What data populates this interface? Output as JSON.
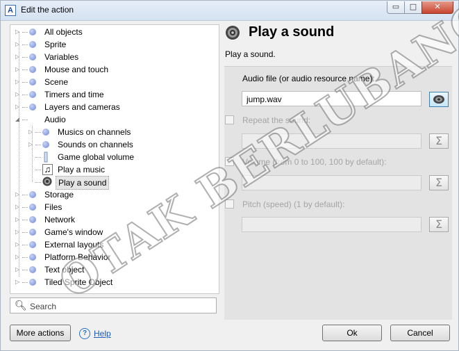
{
  "window": {
    "app_icon": "A",
    "title": "Edit the action",
    "buttons": {
      "minimize": "▭",
      "maximize": "□",
      "close": "✕"
    }
  },
  "tree": {
    "items": [
      {
        "label": "All objects",
        "icon": "bullet-icon",
        "level": 0,
        "expandable": true
      },
      {
        "label": "Sprite",
        "icon": "bullet-icon",
        "level": 0,
        "expandable": true
      },
      {
        "label": "Variables",
        "icon": "bullet-icon",
        "level": 0,
        "expandable": true
      },
      {
        "label": "Mouse and touch",
        "icon": "bullet-icon",
        "level": 0,
        "expandable": true
      },
      {
        "label": "Scene",
        "icon": "bullet-icon",
        "level": 0,
        "expandable": true
      },
      {
        "label": "Timers and time",
        "icon": "bullet-icon",
        "level": 0,
        "expandable": true
      },
      {
        "label": "Layers and cameras",
        "icon": "bullet-icon",
        "level": 0,
        "expandable": true
      },
      {
        "label": "Audio",
        "icon": "",
        "level": 0,
        "expandable": true,
        "expanded": true
      },
      {
        "label": "Musics on channels",
        "icon": "bullet-icon",
        "level": 1,
        "expandable": true
      },
      {
        "label": "Sounds on channels",
        "icon": "bullet-icon",
        "level": 1,
        "expandable": true
      },
      {
        "label": "Game global volume",
        "icon": "volume-icon",
        "level": 1,
        "expandable": false
      },
      {
        "label": "Play a music",
        "icon": "music-note-icon",
        "level": 1,
        "expandable": false
      },
      {
        "label": "Play a sound",
        "icon": "speaker-icon",
        "level": 1,
        "expandable": false,
        "selected": true
      },
      {
        "label": "Storage",
        "icon": "bullet-icon",
        "level": 0,
        "expandable": true
      },
      {
        "label": "Files",
        "icon": "bullet-icon",
        "level": 0,
        "expandable": true
      },
      {
        "label": "Network",
        "icon": "bullet-icon",
        "level": 0,
        "expandable": true
      },
      {
        "label": "Game's window",
        "icon": "bullet-icon",
        "level": 0,
        "expandable": true
      },
      {
        "label": "External layouts",
        "icon": "bullet-icon",
        "level": 0,
        "expandable": true
      },
      {
        "label": "Platform Behavior",
        "icon": "bullet-icon",
        "level": 0,
        "expandable": true
      },
      {
        "label": "Text object",
        "icon": "bullet-icon",
        "level": 0,
        "expandable": true
      },
      {
        "label": "Tiled Sprite Object",
        "icon": "bullet-icon",
        "level": 0,
        "expandable": true
      }
    ]
  },
  "search": {
    "placeholder": "Search",
    "value": ""
  },
  "action": {
    "title": "Play a sound",
    "description": "Play a sound.",
    "icon": "speaker-icon"
  },
  "params": {
    "audio_file": {
      "label": "Audio file (or audio resource name):",
      "value": "jump.wav",
      "button_icon": "speaker-icon"
    },
    "repeat": {
      "label": "Repeat the sound:",
      "checked": false,
      "value": "",
      "button_icon": "sigma-icon"
    },
    "volume": {
      "label": "Volume (from 0 to 100, 100 by default):",
      "checked": false,
      "value": "",
      "button_icon": "sigma-icon"
    },
    "pitch": {
      "label": "Pitch (speed) (1 by default):",
      "checked": false,
      "value": "",
      "button_icon": "sigma-icon"
    }
  },
  "bottom": {
    "more_actions": "More actions",
    "help": "Help",
    "ok": "Ok",
    "cancel": "Cancel"
  },
  "watermark": {
    "text": "OTAK BERLUBANG"
  },
  "colors": {
    "link": "#1e5ab4",
    "selection": "#e5e5e5",
    "disabled_text": "#a5a5a5"
  }
}
